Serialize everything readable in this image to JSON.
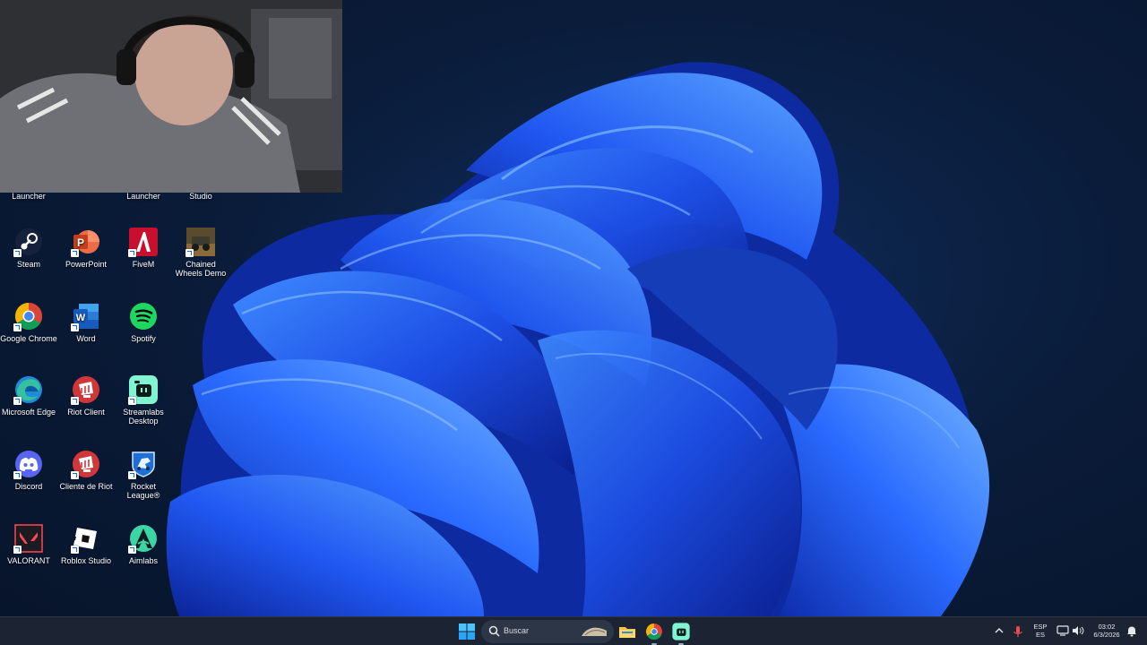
{
  "desktop": {
    "partial_labels": [
      "Launcher",
      "Launcher",
      "Studio"
    ],
    "icons": [
      {
        "label": "Steam",
        "icon": "steam-icon"
      },
      {
        "label": "PowerPoint",
        "icon": "powerpoint-icon"
      },
      {
        "label": "FiveM",
        "icon": "fivem-icon"
      },
      {
        "label": "Chained Wheels Demo",
        "icon": "chained-wheels-icon"
      },
      {
        "label": "Google Chrome",
        "icon": "chrome-icon"
      },
      {
        "label": "Word",
        "icon": "word-icon"
      },
      {
        "label": "Spotify",
        "icon": "spotify-icon"
      },
      {
        "label": "Microsoft Edge",
        "icon": "edge-icon"
      },
      {
        "label": "Riot Client",
        "icon": "riot-client-icon"
      },
      {
        "label": "Streamlabs Desktop",
        "icon": "streamlabs-icon"
      },
      {
        "label": "Discord",
        "icon": "discord-icon"
      },
      {
        "label": "Cliente de Riot",
        "icon": "riot-client-icon"
      },
      {
        "label": "Rocket League®",
        "icon": "rocket-league-icon"
      },
      {
        "label": "VALORANT",
        "icon": "valorant-icon"
      },
      {
        "label": "Roblox Studio",
        "icon": "roblox-studio-icon"
      },
      {
        "label": "Aimlabs",
        "icon": "aimlabs-icon"
      }
    ]
  },
  "taskbar": {
    "search_placeholder": "Buscar",
    "pinned": [
      "file-explorer-icon",
      "chrome-icon",
      "streamlabs-icon"
    ],
    "tray": {
      "lang_top": "ESP",
      "lang_bottom": "ES",
      "time": "03:02",
      "date": "6/3/2026"
    }
  },
  "colors": {
    "taskbar_bg": "#1c2433",
    "wallpaper_accent": "#1f5cf0"
  }
}
